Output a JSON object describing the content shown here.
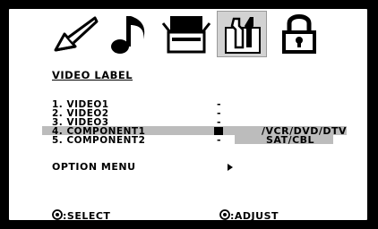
{
  "tabs": [
    {
      "name": "picture",
      "icon": "brush-icon"
    },
    {
      "name": "audio",
      "icon": "music-note-icon"
    },
    {
      "name": "input",
      "icon": "input-box-icon"
    },
    {
      "name": "setup",
      "icon": "tools-icon",
      "selected": true
    },
    {
      "name": "lock",
      "icon": "lock-icon"
    }
  ],
  "section_title": "VIDEO LABEL",
  "items": [
    {
      "label": "1. VIDEO1",
      "value": "-"
    },
    {
      "label": "2. VIDEO2",
      "value": "-"
    },
    {
      "label": "3. VIDEO3",
      "value": "-"
    },
    {
      "label": "4. COMPONENT1",
      "value": "-",
      "highlighted": true
    },
    {
      "label": "5. COMPONENT2",
      "value": "-"
    }
  ],
  "component1_options_line1": "/VCR/DVD/DTV",
  "component1_options_line2": "SAT/CBL",
  "option_menu_label": "OPTION MENU",
  "footer": {
    "select_text": ":SELECT",
    "adjust_text": ":ADJUST"
  }
}
